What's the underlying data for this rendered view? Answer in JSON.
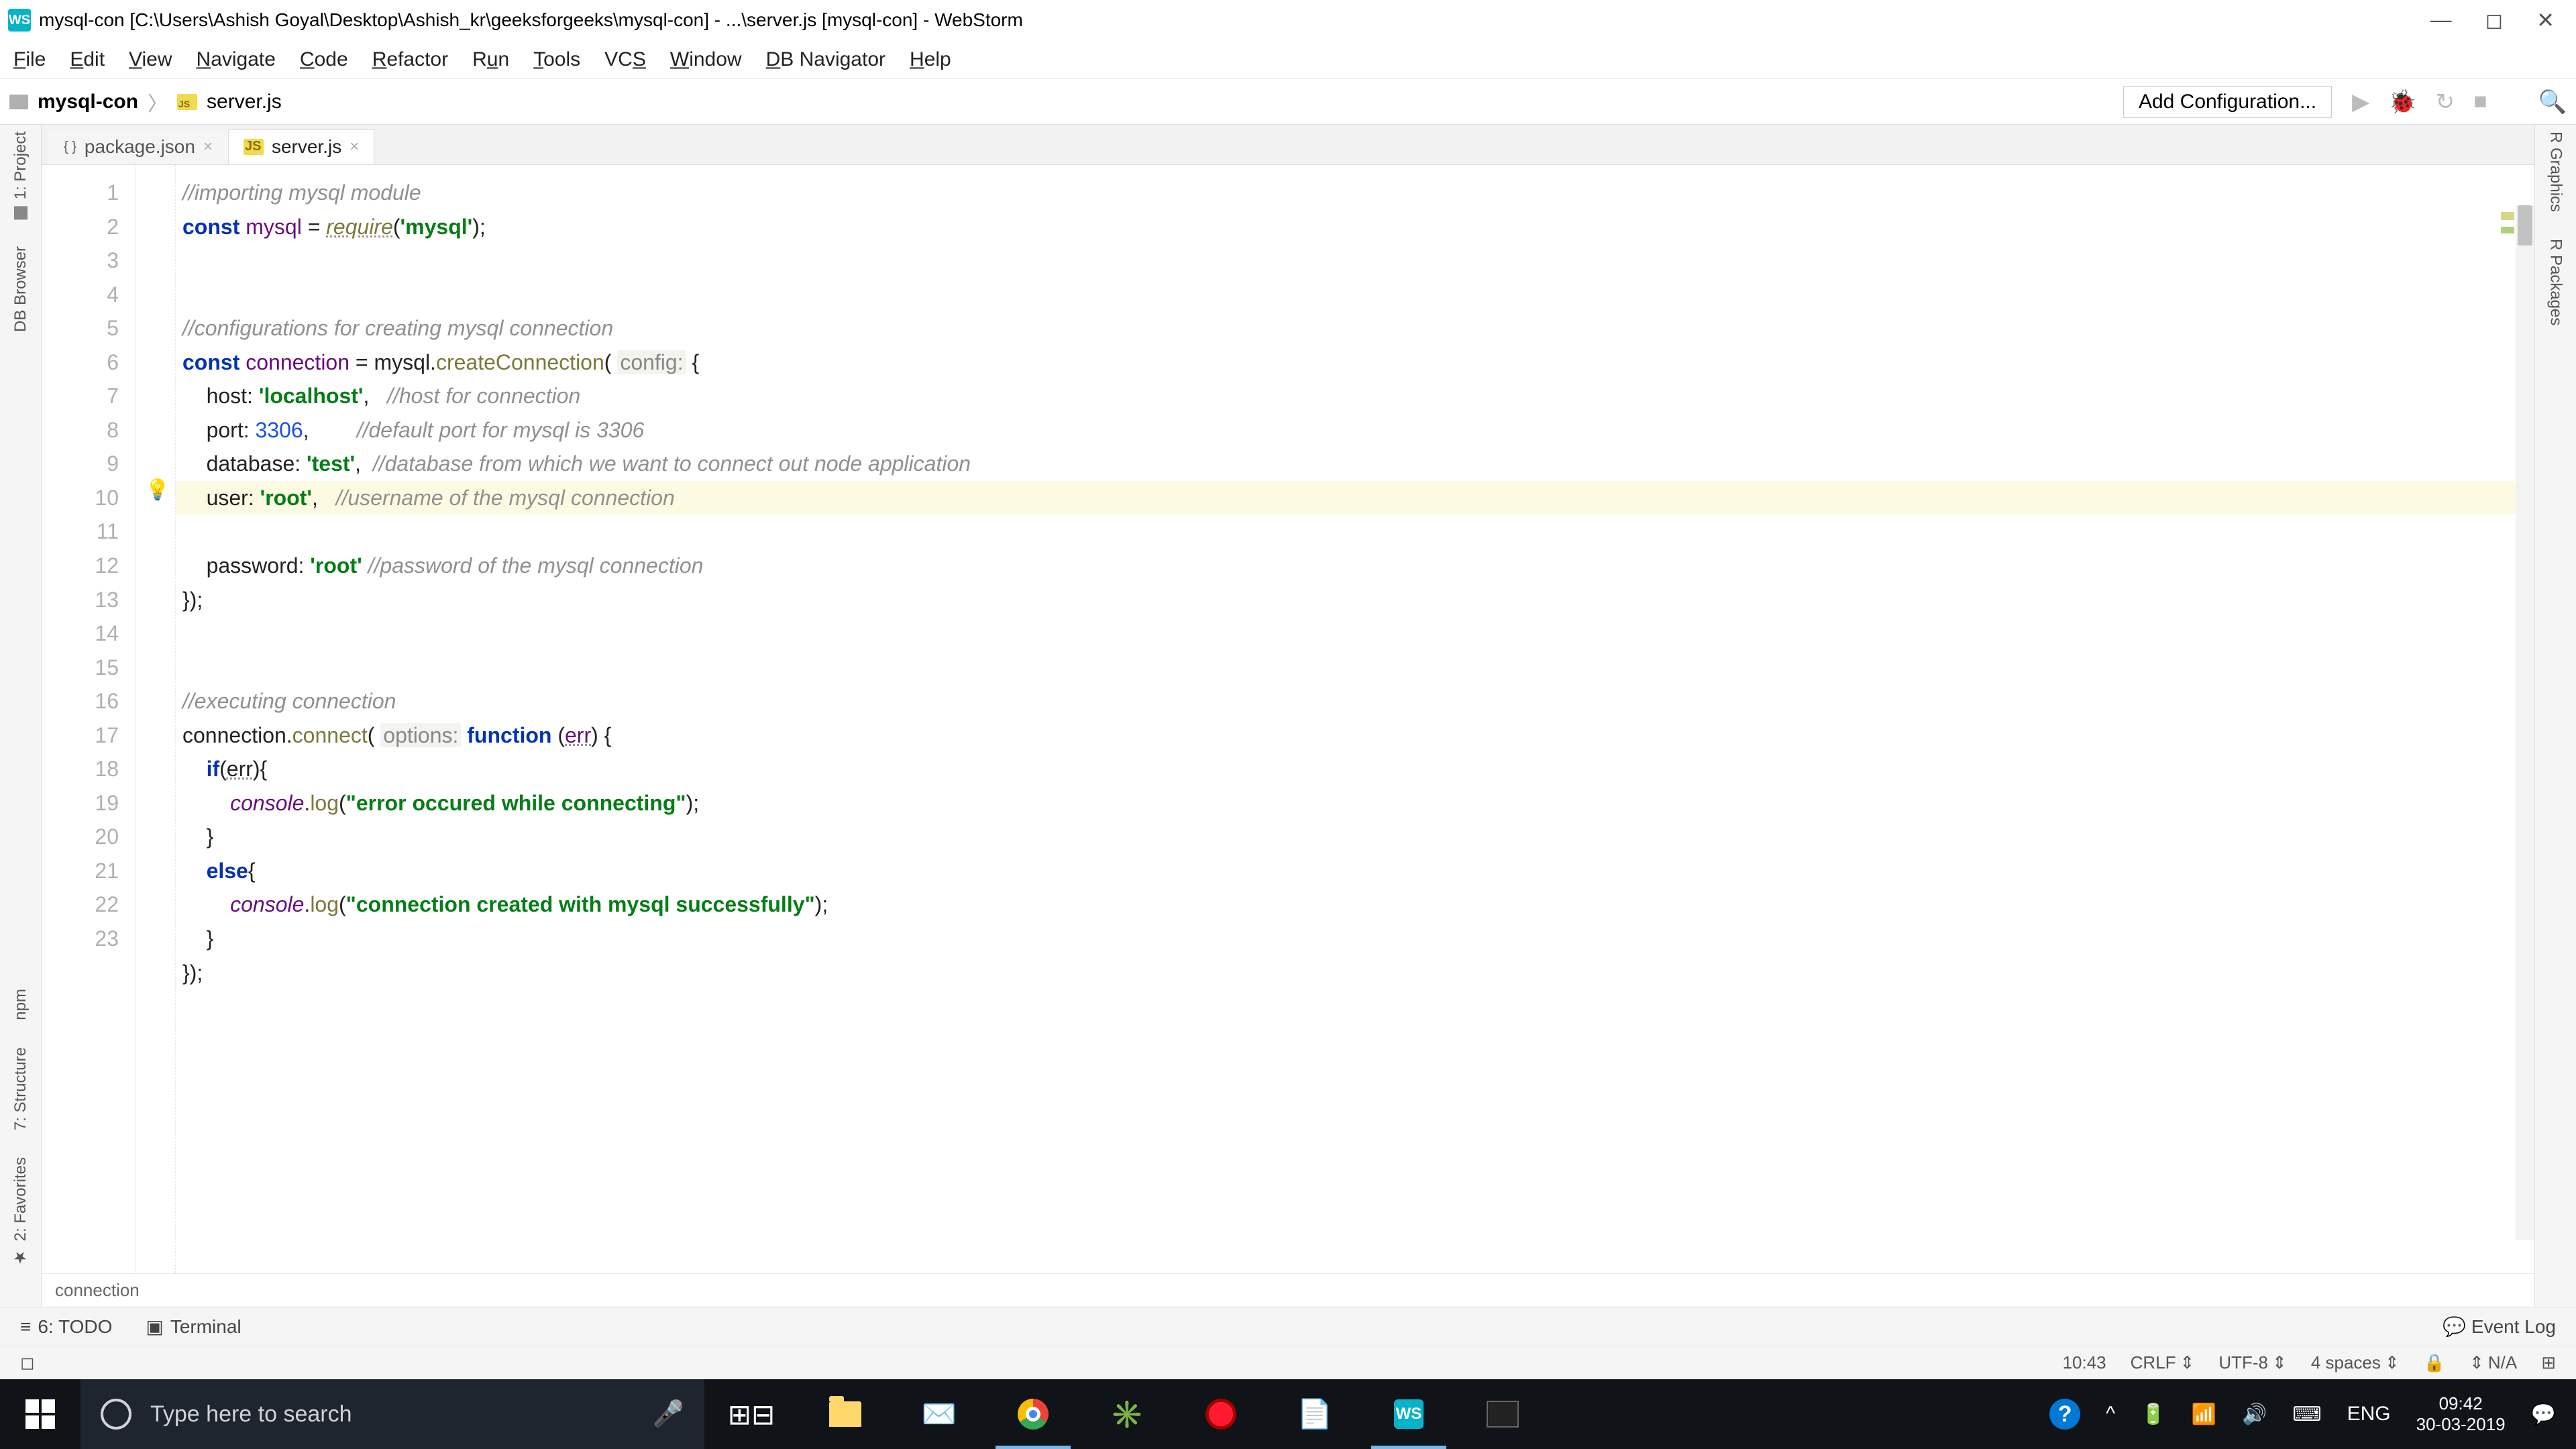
{
  "window": {
    "title": "mysql-con [C:\\Users\\Ashish Goyal\\Desktop\\Ashish_kr\\geeksforgeeks\\mysql-con] - ...\\server.js [mysql-con] - WebStorm"
  },
  "menu": [
    "File",
    "Edit",
    "View",
    "Navigate",
    "Code",
    "Refactor",
    "Run",
    "Tools",
    "VCS",
    "Window",
    "DB Navigator",
    "Help"
  ],
  "breadcrumb": {
    "project": "mysql-con",
    "file": "server.js"
  },
  "toolbar": {
    "add_config": "Add Configuration..."
  },
  "tabs": [
    {
      "name": "package.json",
      "active": false
    },
    {
      "name": "server.js",
      "active": true
    }
  ],
  "left_tools": [
    "1: Project",
    "DB Browser",
    "npm",
    "7: Structure",
    "2: Favorites"
  ],
  "right_tools": [
    "R Graphics",
    "R Packages"
  ],
  "code": {
    "lines": [
      {
        "n": 1,
        "seg": [
          {
            "t": "//importing mysql module",
            "c": "cm"
          }
        ]
      },
      {
        "n": 2,
        "seg": [
          {
            "t": "const ",
            "c": "kw"
          },
          {
            "t": "mysql",
            "c": "def"
          },
          {
            "t": " = "
          },
          {
            "t": "require",
            "c": "fn ul italic"
          },
          {
            "t": "("
          },
          {
            "t": "'mysql'",
            "c": "str"
          },
          {
            "t": ");"
          }
        ]
      },
      {
        "n": 3,
        "seg": [
          {
            "t": ""
          }
        ]
      },
      {
        "n": 4,
        "seg": [
          {
            "t": ""
          }
        ]
      },
      {
        "n": 5,
        "seg": [
          {
            "t": "//configurations for creating mysql connection",
            "c": "cm"
          }
        ]
      },
      {
        "n": 6,
        "seg": [
          {
            "t": "const ",
            "c": "kw"
          },
          {
            "t": "connection",
            "c": "def"
          },
          {
            "t": " = "
          },
          {
            "t": "mysql",
            "c": "obj"
          },
          {
            "t": "."
          },
          {
            "t": "createConnection",
            "c": "fn"
          },
          {
            "t": "( "
          },
          {
            "t": "config:",
            "c": "hint"
          },
          {
            "t": " {"
          }
        ]
      },
      {
        "n": 7,
        "seg": [
          {
            "t": "    host: "
          },
          {
            "t": "'localhost'",
            "c": "str"
          },
          {
            "t": ",   "
          },
          {
            "t": "//host for connection",
            "c": "cm"
          }
        ]
      },
      {
        "n": 8,
        "seg": [
          {
            "t": "    port: "
          },
          {
            "t": "3306",
            "c": "num"
          },
          {
            "t": ",        "
          },
          {
            "t": "//default port for mysql is 3306",
            "c": "cm"
          }
        ]
      },
      {
        "n": 9,
        "seg": [
          {
            "t": "    database: "
          },
          {
            "t": "'test'",
            "c": "str"
          },
          {
            "t": ",  "
          },
          {
            "t": "//database from which we want to connect out node application",
            "c": "cm"
          }
        ]
      },
      {
        "n": 10,
        "hl": true,
        "bulb": true,
        "seg": [
          {
            "t": "    user: "
          },
          {
            "t": "'root'",
            "c": "str"
          },
          {
            "t": ",   "
          },
          {
            "t": "//username of the mysql connection",
            "c": "cm"
          }
        ]
      },
      {
        "n": 11,
        "seg": [
          {
            "t": "    password: "
          },
          {
            "t": "'root'",
            "c": "str"
          },
          {
            "t": " "
          },
          {
            "t": "//password of the mysql connection",
            "c": "cm"
          }
        ]
      },
      {
        "n": 12,
        "seg": [
          {
            "t": "});"
          }
        ]
      },
      {
        "n": 13,
        "seg": [
          {
            "t": ""
          }
        ]
      },
      {
        "n": 14,
        "seg": [
          {
            "t": ""
          }
        ]
      },
      {
        "n": 15,
        "seg": [
          {
            "t": "//executing connection",
            "c": "cm"
          }
        ]
      },
      {
        "n": 16,
        "seg": [
          {
            "t": "connection",
            "c": "obj"
          },
          {
            "t": "."
          },
          {
            "t": "connect",
            "c": "fn"
          },
          {
            "t": "( "
          },
          {
            "t": "options:",
            "c": "hint"
          },
          {
            "t": " "
          },
          {
            "t": "function",
            "c": "kw"
          },
          {
            "t": " ("
          },
          {
            "t": "err",
            "c": "def ul"
          },
          {
            "t": ") {"
          }
        ]
      },
      {
        "n": 17,
        "seg": [
          {
            "t": "    "
          },
          {
            "t": "if",
            "c": "kw"
          },
          {
            "t": "("
          },
          {
            "t": "err",
            "c": "obj ul"
          },
          {
            "t": "){"
          }
        ]
      },
      {
        "n": 18,
        "seg": [
          {
            "t": "        "
          },
          {
            "t": "console",
            "c": "def italic"
          },
          {
            "t": "."
          },
          {
            "t": "log",
            "c": "fn"
          },
          {
            "t": "("
          },
          {
            "t": "\"error occured while connecting\"",
            "c": "str"
          },
          {
            "t": ");"
          }
        ]
      },
      {
        "n": 19,
        "seg": [
          {
            "t": "    }"
          }
        ]
      },
      {
        "n": 20,
        "seg": [
          {
            "t": "    "
          },
          {
            "t": "else",
            "c": "kw"
          },
          {
            "t": "{"
          }
        ]
      },
      {
        "n": 21,
        "seg": [
          {
            "t": "        "
          },
          {
            "t": "console",
            "c": "def italic"
          },
          {
            "t": "."
          },
          {
            "t": "log",
            "c": "fn"
          },
          {
            "t": "("
          },
          {
            "t": "\"connection created with mysql successfully\"",
            "c": "str"
          },
          {
            "t": ");"
          }
        ]
      },
      {
        "n": 22,
        "seg": [
          {
            "t": "    }"
          }
        ]
      },
      {
        "n": 23,
        "seg": [
          {
            "t": "});"
          }
        ]
      }
    ],
    "breadcrumb": "connection"
  },
  "bottom_tools": {
    "todo": "6: TODO",
    "terminal": "Terminal",
    "eventlog": "Event Log"
  },
  "status": {
    "time": "10:43",
    "line_sep": "CRLF",
    "encoding": "UTF-8",
    "indent": "4 spaces",
    "lock": "🔒",
    "inspect": "N/A"
  },
  "taskbar": {
    "search_placeholder": "Type here to search",
    "lang": "ENG",
    "clock_time": "09:42",
    "clock_date": "30-03-2019"
  }
}
